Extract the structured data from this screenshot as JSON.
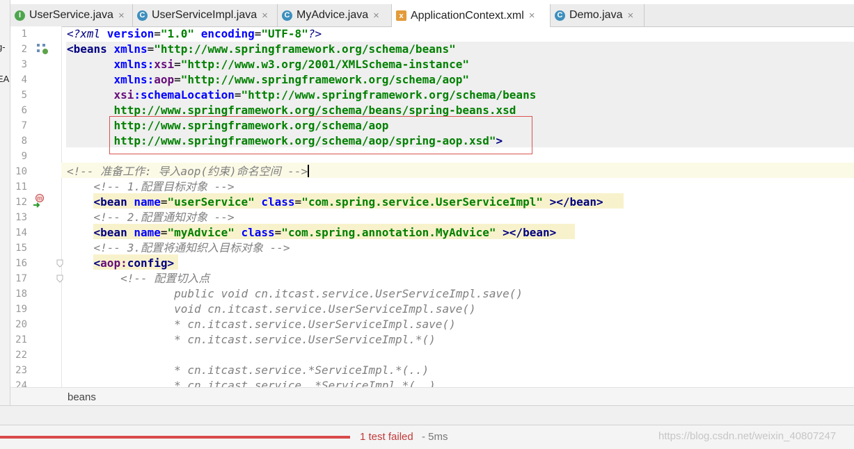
{
  "tabs": [
    {
      "label": "UserService.java",
      "icon": "interface-icon",
      "icon_glyph": "I",
      "active": false
    },
    {
      "label": "UserServiceImpl.java",
      "icon": "class-icon",
      "icon_glyph": "C",
      "active": false
    },
    {
      "label": "MyAdvice.java",
      "icon": "class-icon",
      "icon_glyph": "C",
      "active": false
    },
    {
      "label": "ApplicationContext.xml",
      "icon": "xml-icon",
      "icon_glyph": "x",
      "active": true
    },
    {
      "label": "Demo.java",
      "icon": "class-icon",
      "icon_glyph": "C",
      "active": false
    }
  ],
  "close_glyph": "×",
  "left_fragments": [
    "g-",
    "EA"
  ],
  "line_numbers": [
    "1",
    "2",
    "3",
    "4",
    "5",
    "6",
    "7",
    "8",
    "9",
    "10",
    "11",
    "12",
    "13",
    "14",
    "15",
    "16",
    "17",
    "18",
    "19",
    "20",
    "21",
    "22",
    "23",
    "24"
  ],
  "code": {
    "l1": {
      "a": "<?xml ",
      "b": "version",
      "c": "=",
      "d": "\"1.0\"",
      "e": " ",
      "f": "encoding",
      "g": "=",
      "h": "\"UTF-8\"",
      "i": "?>"
    },
    "l2": {
      "a": "<beans ",
      "b": "xmlns",
      "c": "=",
      "d": "\"http://www.springframework.org/schema/beans\""
    },
    "l3": {
      "a": "       ",
      "b": "xmlns:",
      "c": "xsi",
      "d": "=",
      "e": "\"http://www.w3.org/2001/XMLSchema-instance\""
    },
    "l4": {
      "a": "       ",
      "b": "xmlns:",
      "c": "aop",
      "d": "=",
      "e": "\"http://www.springframework.org/schema/aop\""
    },
    "l5": {
      "a": "       ",
      "b": "xsi",
      "c": ":schemaLocation",
      "d": "=",
      "e": "\"http://www.springframework.org/schema/beans"
    },
    "l6": {
      "a": "       ",
      "b": "http://www.springframework.org/schema/beans/spring-beans.xsd"
    },
    "l7": {
      "a": "       ",
      "b": "http://www.springframework.org/schema/aop"
    },
    "l8": {
      "a": "       ",
      "b": "http://www.springframework.org/schema/aop/spring-aop.xsd\"",
      "c": ">"
    },
    "l10": {
      "a": "<!-- 准备工作: 导入aop(约束)命名空间 -->"
    },
    "l11": {
      "a": "    ",
      "b": "<!-- 1.配置目标对象 -->"
    },
    "l12": {
      "a": "    ",
      "b": "<bean ",
      "c": "name",
      "d": "=",
      "e": "\"userService\"",
      "f": " ",
      "g": "class",
      "h": "=",
      "i": "\"com.spring.service.UserServiceImpl\"",
      "j": " ></bean>"
    },
    "l13": {
      "a": "    ",
      "b": "<!-- 2.配置通知对象 -->"
    },
    "l14": {
      "a": "    ",
      "b": "<bean ",
      "c": "name",
      "d": "=",
      "e": "\"myAdvice\"",
      "f": " ",
      "g": "class",
      "h": "=",
      "i": "\"com.spring.annotation.MyAdvice\"",
      "j": " ></bean>"
    },
    "l15": {
      "a": "    ",
      "b": "<!-- 3.配置将通知织入目标对象 -->"
    },
    "l16": {
      "a": "    ",
      "b": "<",
      "c": "aop:",
      "d": "config",
      "e": ">"
    },
    "l17": {
      "a": "        ",
      "b": "<!-- 配置切入点"
    },
    "l18": {
      "a": "                ",
      "b": "public void cn.itcast.service.UserServiceImpl.save()"
    },
    "l19": {
      "a": "                ",
      "b": "void cn.itcast.service.UserServiceImpl.save()"
    },
    "l20": {
      "a": "                ",
      "b": "* cn.itcast.service.UserServiceImpl.save()"
    },
    "l21": {
      "a": "                ",
      "b": "* cn.itcast.service.UserServiceImpl.*()"
    },
    "l23": {
      "a": "                ",
      "b": "* cn.itcast.service.*ServiceImpl.*(..)"
    },
    "l24": {
      "a": "                ",
      "b": "* cn.itcast.service..*ServiceImpl.*(..)"
    }
  },
  "breadcrumb": "beans",
  "status": {
    "result": "1 test failed",
    "duration": "- 5ms",
    "progress": 1.0
  },
  "watermark": "https://blog.csdn.net/weixin_40807247",
  "colors": {
    "tag": "#000080",
    "attribute": "#0000ff",
    "namespace": "#660e7a",
    "value": "#008000",
    "comment": "#808080",
    "fail": "#c23a3a"
  }
}
